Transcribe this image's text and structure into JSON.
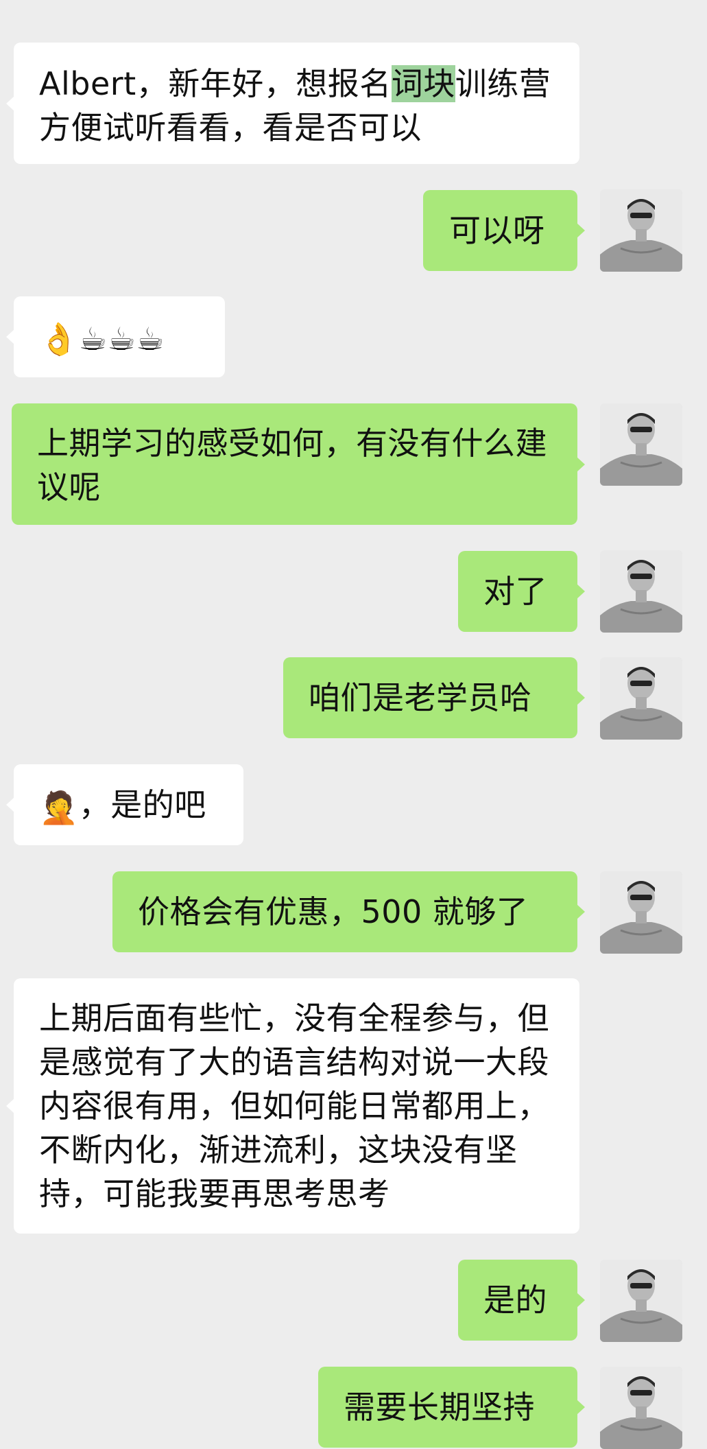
{
  "messages": [
    {
      "side": "in",
      "text_before": "Albert，新年好，想报名",
      "highlight": "词块",
      "text_after": "训练营方便试听看看，看是否可以"
    },
    {
      "side": "out",
      "text": "可以呀"
    },
    {
      "side": "in",
      "emoji": [
        "👌",
        "☕",
        "☕",
        "☕"
      ]
    },
    {
      "side": "out",
      "text": "上期学习的感受如何，有没有什么建议呢"
    },
    {
      "side": "out",
      "text": "对了"
    },
    {
      "side": "out",
      "text": "咱们是老学员哈"
    },
    {
      "side": "in",
      "emoji_prefix": "🤦",
      "text": "，是的吧"
    },
    {
      "side": "out",
      "text": "价格会有优惠，500 就够了"
    },
    {
      "side": "in",
      "text": "上期后面有些忙，没有全程参与，但是感觉有了大的语言结构对说一大段内容很有用，但如何能日常都用上，不断内化，渐进流利，这块没有坚持，可能我要再思考思考"
    },
    {
      "side": "out",
      "text": "是的"
    },
    {
      "side": "out",
      "text": "需要长期坚持"
    }
  ],
  "colors": {
    "background": "#ededed",
    "incoming_bubble": "#ffffff",
    "outgoing_bubble": "#a9e87a",
    "highlight": "#9ed39d"
  },
  "avatar": {
    "icon": "user-avatar-photo"
  }
}
